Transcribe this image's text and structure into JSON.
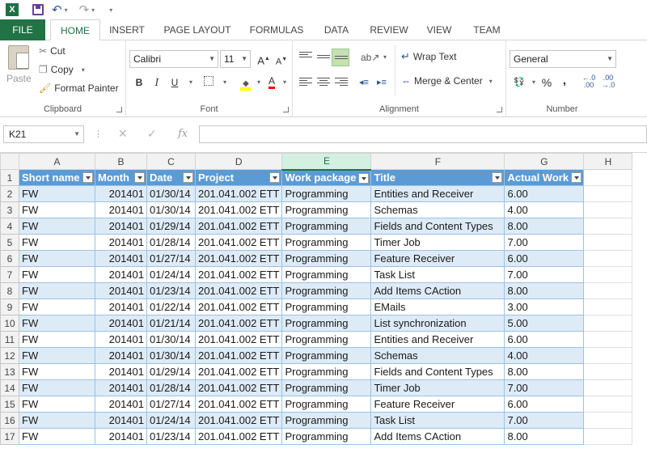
{
  "quick_access": {
    "app_icon_letter": "X",
    "undo_glyph": "↶",
    "redo_glyph": "↷",
    "customize_glyph": "▾"
  },
  "tabs": [
    "FILE",
    "HOME",
    "INSERT",
    "PAGE LAYOUT",
    "FORMULAS",
    "DATA",
    "REVIEW",
    "VIEW",
    "TEAM"
  ],
  "active_tab": "HOME",
  "ribbon": {
    "clipboard": {
      "paste": "Paste",
      "cut": "Cut",
      "copy": "Copy",
      "format_painter": "Format Painter",
      "label": "Clipboard"
    },
    "font": {
      "name": "Calibri",
      "size": "11",
      "grow": "A",
      "shrink": "A",
      "bold": "B",
      "italic": "I",
      "underline": "U",
      "font_color_glyph": "A",
      "label": "Font"
    },
    "alignment": {
      "wrap_text": "Wrap Text",
      "merge_center": "Merge & Center",
      "label": "Alignment"
    },
    "number": {
      "format": "General",
      "percent": "%",
      "comma": ",",
      "label": "Number"
    }
  },
  "formula_bar": {
    "name_box": "K21",
    "cancel": "✕",
    "enter": "✓",
    "fx": "fx",
    "value": ""
  },
  "sheet": {
    "columns": [
      "A",
      "B",
      "C",
      "D",
      "E",
      "F",
      "G",
      "H"
    ],
    "selected_column": "E",
    "headers": [
      "Short name",
      "Month",
      "Date",
      "Project",
      "Work package",
      "Title",
      "Actual Work"
    ],
    "rows": [
      {
        "n": "1"
      },
      {
        "n": "2",
        "cells": [
          "FW",
          "201401",
          "01/30/14",
          "201.041.002 ETT",
          "Programming",
          "Entities and Receiver",
          "6.00"
        ]
      },
      {
        "n": "3",
        "cells": [
          "FW",
          "201401",
          "01/30/14",
          "201.041.002 ETT",
          "Programming",
          "Schemas",
          "4.00"
        ]
      },
      {
        "n": "4",
        "cells": [
          "FW",
          "201401",
          "01/29/14",
          "201.041.002 ETT",
          "Programming",
          "Fields and Content Types",
          "8.00"
        ]
      },
      {
        "n": "5",
        "cells": [
          "FW",
          "201401",
          "01/28/14",
          "201.041.002 ETT",
          "Programming",
          "Timer Job",
          "7.00"
        ]
      },
      {
        "n": "6",
        "cells": [
          "FW",
          "201401",
          "01/27/14",
          "201.041.002 ETT",
          "Programming",
          "Feature Receiver",
          "6.00"
        ]
      },
      {
        "n": "7",
        "cells": [
          "FW",
          "201401",
          "01/24/14",
          "201.041.002 ETT",
          "Programming",
          "Task List",
          "7.00"
        ]
      },
      {
        "n": "8",
        "cells": [
          "FW",
          "201401",
          "01/23/14",
          "201.041.002 ETT",
          "Programming",
          "Add Items CAction",
          "8.00"
        ]
      },
      {
        "n": "9",
        "cells": [
          "FW",
          "201401",
          "01/22/14",
          "201.041.002 ETT",
          "Programming",
          "EMails",
          "3.00"
        ]
      },
      {
        "n": "10",
        "cells": [
          "FW",
          "201401",
          "01/21/14",
          "201.041.002 ETT",
          "Programming",
          "List synchronization",
          "5.00"
        ]
      },
      {
        "n": "11",
        "cells": [
          "FW",
          "201401",
          "01/30/14",
          "201.041.002 ETT",
          "Programming",
          "Entities and Receiver",
          "6.00"
        ]
      },
      {
        "n": "12",
        "cells": [
          "FW",
          "201401",
          "01/30/14",
          "201.041.002 ETT",
          "Programming",
          "Schemas",
          "4.00"
        ]
      },
      {
        "n": "13",
        "cells": [
          "FW",
          "201401",
          "01/29/14",
          "201.041.002 ETT",
          "Programming",
          "Fields and Content Types",
          "8.00"
        ]
      },
      {
        "n": "14",
        "cells": [
          "FW",
          "201401",
          "01/28/14",
          "201.041.002 ETT",
          "Programming",
          "Timer Job",
          "7.00"
        ]
      },
      {
        "n": "15",
        "cells": [
          "FW",
          "201401",
          "01/27/14",
          "201.041.002 ETT",
          "Programming",
          "Feature Receiver",
          "6.00"
        ]
      },
      {
        "n": "16",
        "cells": [
          "FW",
          "201401",
          "01/24/14",
          "201.041.002 ETT",
          "Programming",
          "Task List",
          "7.00"
        ]
      },
      {
        "n": "17",
        "cells": [
          "FW",
          "201401",
          "01/23/14",
          "201.041.002 ETT",
          "Programming",
          "Add Items CAction",
          "8.00"
        ]
      }
    ]
  },
  "colors": {
    "excel_green": "#217346",
    "table_header": "#5b9bd5",
    "band": "#ddebf7"
  }
}
